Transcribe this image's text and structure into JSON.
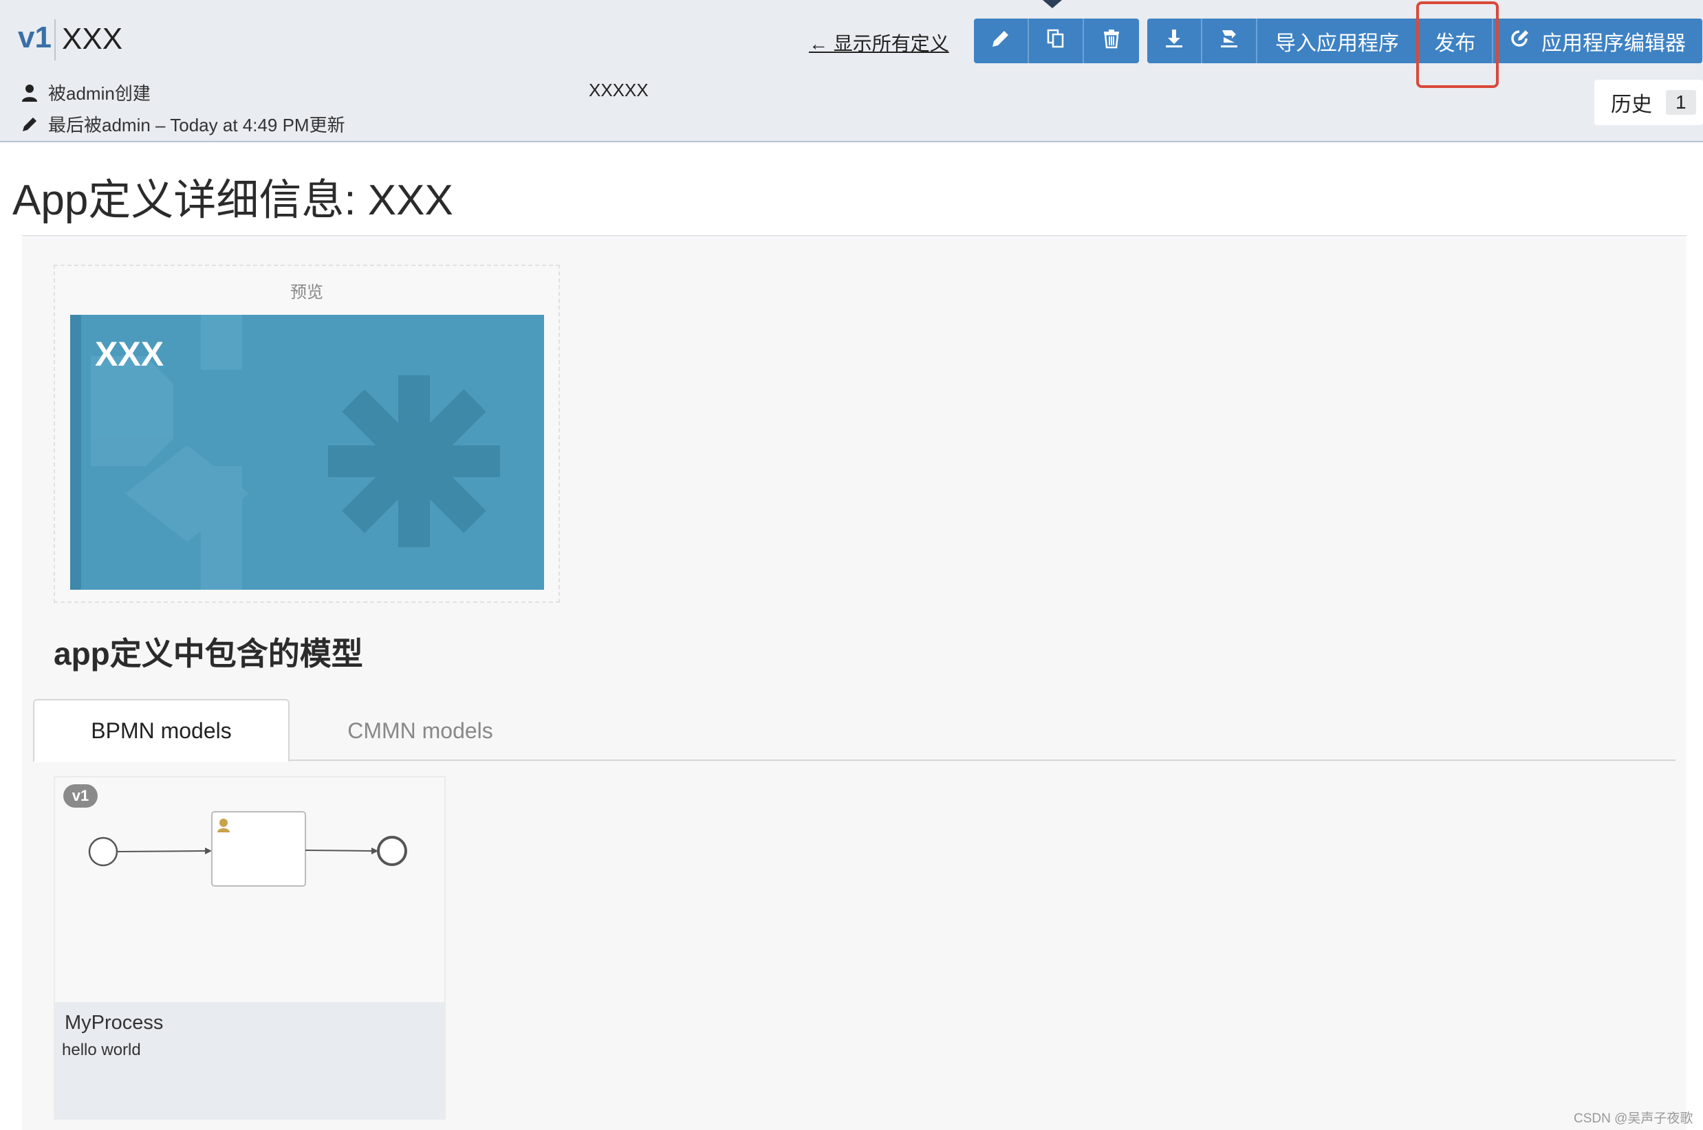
{
  "header": {
    "version": "v1",
    "app_title": "XXX",
    "created_by": "被admin创建",
    "updated_by": "最后被admin – Today at 4:49 PM更新",
    "description": "XXXXX",
    "back_link": "← 显示所有定义",
    "toolbar": {
      "edit_icon": "pencil-icon",
      "copy_icon": "copy-icon",
      "delete_icon": "trash-icon",
      "download_icon": "download-icon",
      "export_icon": "export-icon",
      "import_label": "导入应用程序",
      "publish_label": "发布",
      "editor_icon": "edit-square-icon",
      "editor_label": "应用程序编辑器"
    },
    "history": {
      "label": "历史",
      "count": "1"
    }
  },
  "page_title": "App定义详细信息: XXX",
  "preview": {
    "label": "预览",
    "tile_name": "XXX",
    "tile_color": "#4c9bbd"
  },
  "models": {
    "heading": "app定义中包含的模型",
    "tabs": [
      {
        "label": "BPMN models",
        "active": true
      },
      {
        "label": "CMMN models",
        "active": false
      }
    ],
    "cards": [
      {
        "version": "v1",
        "name": "MyProcess",
        "description": "hello world"
      }
    ]
  },
  "watermark": "CSDN @吴声子夜歌",
  "colors": {
    "primary_button": "#3e82c4",
    "highlight": "#d9493a",
    "header_bg": "#e9ecf0"
  }
}
